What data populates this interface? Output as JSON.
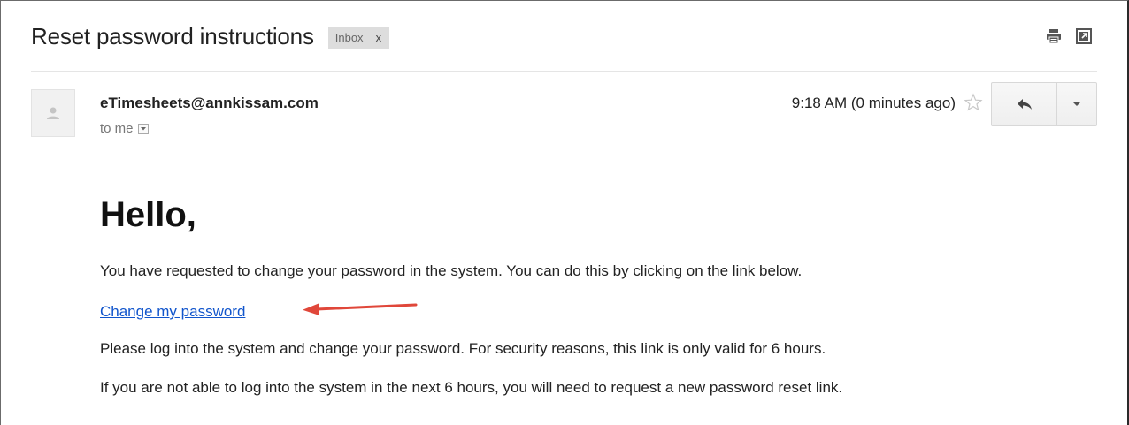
{
  "email": {
    "subject": "Reset password instructions",
    "label": {
      "name": "Inbox",
      "remove": "x"
    },
    "toolbar_icons": [
      "print-icon",
      "open-in-new-window-icon"
    ],
    "sender": "eTimesheets@annkissam.com",
    "recipient": "to me",
    "timestamp": "9:18 AM (0 minutes ago)",
    "starred": false,
    "actions": {
      "reply_icon": "reply-icon",
      "more_icon": "chevron-down-icon"
    },
    "body": {
      "greeting": "Hello,",
      "intro": "You have requested to change your password in the system. You can do this by clicking on the link below.",
      "link_text": "Change my password",
      "security_note": "Please log into the system and change your password. For security reasons, this link is only valid for 6 hours.",
      "expiry_note": "If you are not able to log into the system in the next 6 hours, you will need to request a new password reset link."
    }
  },
  "colors": {
    "link": "#1155cc",
    "annotation_arrow": "#e0473a",
    "label_chip_bg": "#dddddd"
  }
}
